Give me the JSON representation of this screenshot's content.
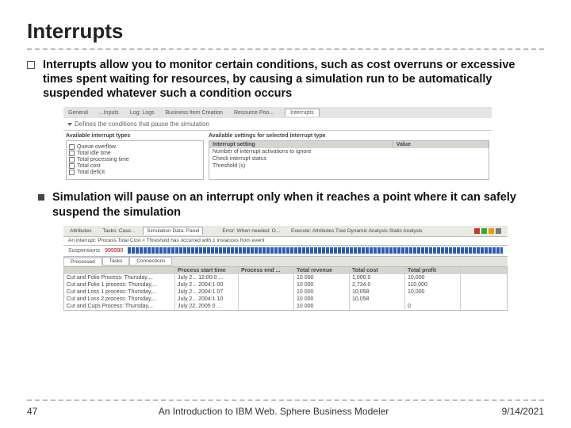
{
  "title": "Interrupts",
  "p1": "Interrupts allow you to monitor certain conditions, such as cost overruns or excessive times spent waiting for resources, by causing a simulation run to be automatically suspended whatever such a condition occurs",
  "p2": "Simulation will pause on an interrupt only when it reaches a point where it can safely suspend the simulation",
  "sc1": {
    "tabs": [
      "General",
      "...Inputs",
      "Log: Logs",
      "Business Item Creation",
      "Resource Poo...",
      "Interrupts"
    ],
    "sub": "Defines the conditions that pause the simulation",
    "left_title": "Available interrupt types",
    "checks": [
      "Queue overflow",
      "Total idle time",
      "Total processing time",
      "Total cost",
      "Total deficit"
    ],
    "right_title": "Available settings for selected interrupt type",
    "col_a": "Interrupt setting",
    "col_b": "Value",
    "rows": [
      "Number of interrupt activations to ignore",
      "Check interrupt status",
      "Threshold (s)"
    ]
  },
  "sc2": {
    "tabs": [
      "Attributes",
      "Tasks: Case...",
      "Simulation Data: Panel",
      "",
      "Error: When needed: O...",
      "Execute: Attributes Tree Dynamic Analysis Static Analysis"
    ],
    "banner": "An interrupt: Process Total Cost > Threshold has occurred with 1 instances from event",
    "lbl": "Suspensions",
    "count": "999990",
    "tab2a": "Processed",
    "tab2b": "Tasks",
    "tab2c": "Connections",
    "hdr": [
      "",
      "Process start time",
      "Process end ...",
      "Total revenue",
      "Total cost",
      "Total profit"
    ],
    "rows": [
      [
        "Cut and Folio Process: Thursday,...",
        "July 2...  12:00:0 ...",
        "",
        "10 000",
        "1,000.0",
        "10,000"
      ],
      [
        "Cut and Folio 1 process: Thursday,...",
        "July 2...  2004:1 00",
        "",
        "10 000",
        "2,734.0",
        "110,000"
      ],
      [
        "Cut and Loss 1 process: Thursday,...",
        "July 2...  2004:1 07",
        "",
        "10 000",
        "10,058",
        "10,000"
      ],
      [
        "Cut and Loss 2 process: Thursday,...",
        "July 2...  2004:1 10",
        "",
        "10 000",
        "10,058",
        ""
      ],
      [
        "Cut and Cups Process: Thursday,...",
        "July 22,  2005 0 ...",
        "",
        "10 000",
        "",
        "0"
      ]
    ]
  },
  "footer": {
    "page": "47",
    "title": "An Introduction to IBM Web. Sphere Business Modeler",
    "date": "9/14/2021"
  }
}
